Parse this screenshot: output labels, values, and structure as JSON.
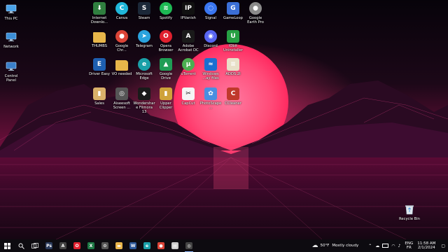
{
  "desktop": {
    "left_column": [
      {
        "label": "This PC",
        "icon": "this-pc-icon",
        "color": "#4aa3e8"
      },
      {
        "label": "Network",
        "icon": "network-icon",
        "color": "#3c8fd8"
      },
      {
        "label": "Control Panel",
        "icon": "control-panel-icon",
        "color": "#3a7fc9"
      }
    ],
    "grid": [
      [
        {
          "label": "Internet Downlo...",
          "icon": "internet-download-manager-icon",
          "color": "#2f7f3f",
          "glyph": "⬇"
        },
        {
          "label": "Canva",
          "icon": "canva-icon",
          "color": "#20b7d9",
          "glyph": "C",
          "round": true
        },
        {
          "label": "Steam",
          "icon": "steam-icon",
          "color": "#1b2838",
          "glyph": "S"
        },
        {
          "label": "Spotify",
          "icon": "spotify-icon",
          "color": "#1db954",
          "glyph": "≋",
          "round": true
        },
        {
          "label": "IPVanish",
          "icon": "ipvanish-icon",
          "color": "#111111",
          "glyph": "IP"
        },
        {
          "label": "Signal",
          "icon": "signal-icon",
          "color": "#3a76f0",
          "glyph": "◌",
          "round": true
        },
        {
          "label": "GameLoop",
          "icon": "gameloop-icon",
          "color": "#3b6fd6",
          "glyph": "G"
        },
        {
          "label": "Google Earth Pro",
          "icon": "google-earth-pro-icon",
          "color": "#8a8a8a",
          "glyph": "●",
          "round": true
        }
      ],
      [
        {
          "label": "THUMBS",
          "icon": "folder-icon",
          "color": "#e8b64a",
          "glyph": ""
        },
        {
          "label": "Google Chr...",
          "icon": "google-chrome-icon",
          "color": "#db4437",
          "glyph": "●",
          "round": true
        },
        {
          "label": "Telegram",
          "icon": "telegram-icon",
          "color": "#2aa3de",
          "glyph": "➤",
          "round": true
        },
        {
          "label": "Opera Browser",
          "icon": "opera-icon",
          "color": "#e0202e",
          "glyph": "O",
          "round": true
        },
        {
          "label": "Adobe Acrobat DC",
          "icon": "adobe-acrobat-icon",
          "color": "#1a1a1a",
          "glyph": "A"
        },
        {
          "label": "Discord",
          "icon": "discord-icon",
          "color": "#5865f2",
          "glyph": "◉",
          "round": true
        },
        {
          "label": "IObit Uninstaller",
          "icon": "iobit-uninstaller-icon",
          "color": "#26a043",
          "glyph": "U"
        }
      ],
      [
        {
          "label": "Driver Easy",
          "icon": "driver-easy-icon",
          "color": "#1e5fb0",
          "glyph": "E"
        },
        {
          "label": "VO needed",
          "icon": "folder-icon",
          "color": "#e8b64a",
          "glyph": ""
        },
        {
          "label": "Microsoft Edge",
          "icon": "microsoft-edge-icon",
          "color": "#1aa0a8",
          "glyph": "e",
          "round": true
        },
        {
          "label": "Google Drive",
          "icon": "google-drive-icon",
          "color": "#1f9d55",
          "glyph": "▲"
        },
        {
          "label": "uTorrent",
          "icon": "utorrent-icon",
          "color": "#4caf50",
          "glyph": "μ",
          "round": true
        },
        {
          "label": "Windows ...ay files",
          "icon": "windows-display-icon",
          "color": "#1a6fd0",
          "glyph": "≈"
        },
        {
          "label": "ADDS.2I",
          "icon": "document-icon",
          "color": "#e8e0c8",
          "glyph": "≡"
        }
      ],
      [
        {
          "label": "Sales",
          "icon": "sales-folder-icon",
          "color": "#d9b06a",
          "glyph": "▮"
        },
        {
          "label": "Aiseesoft Screen ...",
          "icon": "aiseesoft-screen-recorder-icon",
          "color": "#555555",
          "glyph": "◎"
        },
        {
          "label": "Wondershare Filmora 13",
          "icon": "wondershare-filmora-icon",
          "color": "#1a1a1a",
          "glyph": "◆"
        },
        {
          "label": "Upper Clipper",
          "icon": "upper-clipper-icon",
          "color": "#cfa23a",
          "glyph": "▮"
        },
        {
          "label": "CapCut",
          "icon": "capcut-icon",
          "color": "#f5f5f5",
          "glyph": "✂",
          "dark": true
        },
        {
          "label": "PhotoScape...",
          "icon": "photoscape-icon",
          "color": "#4a8fe0",
          "glyph": "✿"
        },
        {
          "label": "CCleaner",
          "icon": "ccleaner-icon",
          "color": "#c0392b",
          "glyph": "C"
        }
      ]
    ],
    "recycle_bin": {
      "label": "Recycle Bin",
      "icon": "recycle-bin-icon"
    }
  },
  "taskbar": {
    "apps": [
      {
        "name": "start-button",
        "icon": "windows-logo-icon",
        "color": "#ffffff"
      },
      {
        "name": "search-button",
        "icon": "search-icon",
        "color": "#ffffff"
      },
      {
        "name": "task-view-button",
        "icon": "task-view-icon",
        "color": "#ffffff"
      },
      {
        "name": "taskbar-app-photoshop",
        "icon": "photoshop-icon",
        "color": "#2a3a5a",
        "glyph": "Ps"
      },
      {
        "name": "taskbar-app-files",
        "icon": "files-icon",
        "color": "#444444",
        "glyph": "A"
      },
      {
        "name": "taskbar-app-opera",
        "icon": "opera-icon",
        "color": "#e0202e",
        "glyph": "O"
      },
      {
        "name": "taskbar-app-excel",
        "icon": "excel-icon",
        "color": "#1e7a45",
        "glyph": "X"
      },
      {
        "name": "taskbar-app-settings",
        "icon": "settings-icon",
        "color": "#555555",
        "glyph": "⚙"
      },
      {
        "name": "taskbar-app-file-explorer",
        "icon": "file-explorer-icon",
        "color": "#e8b64a",
        "glyph": "▬"
      },
      {
        "name": "taskbar-app-word",
        "icon": "word-icon",
        "color": "#2b5797",
        "glyph": "W"
      },
      {
        "name": "taskbar-app-edge",
        "icon": "edge-icon",
        "color": "#1aa0a8",
        "glyph": "e"
      },
      {
        "name": "taskbar-app-chrome",
        "icon": "chrome-icon",
        "color": "#db4437",
        "glyph": "●"
      },
      {
        "name": "taskbar-app-notes",
        "icon": "notes-icon",
        "color": "#cccccc",
        "glyph": "▤"
      },
      {
        "name": "taskbar-app-screen-recorder",
        "icon": "screen-recorder-icon",
        "color": "#444444",
        "glyph": "◎",
        "active": true
      }
    ],
    "weather": {
      "temp": "50°F",
      "condition": "Mostly cloudy"
    },
    "language": {
      "line1": "ENG",
      "line2": "FR"
    },
    "clock": {
      "time": "11:58 AM",
      "date": "2/1/2024"
    }
  }
}
